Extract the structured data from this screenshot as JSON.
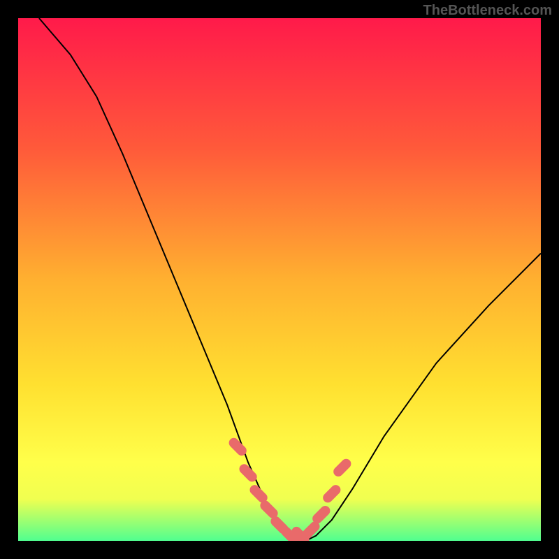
{
  "watermark": "TheBottleneck.com",
  "chart_data": {
    "type": "line",
    "title": "",
    "xlabel": "",
    "ylabel": "",
    "xlim": [
      0,
      100
    ],
    "ylim": [
      0,
      100
    ],
    "series": [
      {
        "name": "bottleneck-curve",
        "x": [
          4,
          10,
          15,
          20,
          25,
          30,
          35,
          40,
          44,
          48,
          51,
          53,
          55,
          57,
          60,
          64,
          70,
          80,
          90,
          100
        ],
        "y": [
          100,
          93,
          85,
          74,
          62,
          50,
          38,
          26,
          15,
          6,
          2,
          0,
          0,
          1,
          4,
          10,
          20,
          34,
          45,
          55
        ]
      }
    ],
    "markers": {
      "name": "bottleneck-highlight-points",
      "x": [
        42,
        44,
        46,
        48,
        50,
        52,
        54,
        56,
        58,
        60,
        62
      ],
      "y": [
        18,
        13,
        9,
        6,
        3,
        1,
        1,
        2,
        5,
        9,
        14
      ]
    },
    "gradient_colors": {
      "top": "#ff1a4a",
      "mid_upper": "#ff5a3a",
      "mid": "#ffb030",
      "mid_lower": "#ffe030",
      "lower": "#ffff4a",
      "bottom": "#50ff90"
    }
  }
}
